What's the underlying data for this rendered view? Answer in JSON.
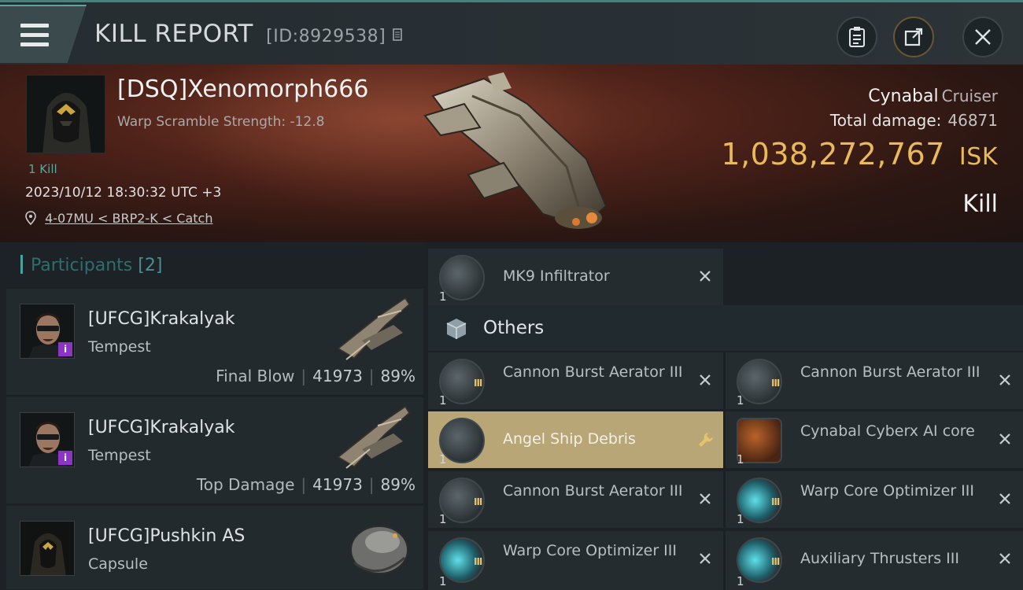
{
  "header": {
    "title": "KILL REPORT",
    "id_text": "[ID:8929538]",
    "buttons": {
      "report": "clipboard-icon",
      "share": "share-icon",
      "close": "close-icon"
    }
  },
  "victim": {
    "name": "[DSQ]Xenomorph666",
    "scramble": "Warp Scramble Strength: -12.8",
    "kill_count": "1 Kill",
    "datetime": "2023/10/12 18:30:32 UTC +3",
    "location": "4-07MU < BRP2-K < Catch",
    "ship": "Cynabal",
    "ship_class": "Cruiser",
    "total_damage_label": "Total damage:",
    "total_damage": "46871",
    "isk_value": "1,038,272,767",
    "isk_unit": "ISK",
    "result": "Kill"
  },
  "participants": {
    "title": "Participants",
    "count": "[2]",
    "list": [
      {
        "name": "[UFCG]Krakalyak",
        "ship": "Tempest",
        "role": "Final Blow",
        "damage": "41973",
        "percent": "89%"
      },
      {
        "name": "[UFCG]Krakalyak",
        "ship": "Tempest",
        "role": "Top Damage",
        "damage": "41973",
        "percent": "89%"
      },
      {
        "name": "[UFCG]Pushkin AS",
        "ship": "Capsule"
      }
    ]
  },
  "items": {
    "top": {
      "label": "MK9  Infiltrator",
      "qty": "1"
    },
    "others_title": "Others",
    "grid": [
      {
        "label": "Cannon Burst Aerator III",
        "qty": "1",
        "tier": "III"
      },
      {
        "label": "Cannon Burst Aerator III",
        "qty": "1",
        "tier": "III"
      },
      {
        "label": "Angel Ship Debris",
        "qty": "1",
        "highlight": true
      },
      {
        "label": "Cynabal Cyberx AI core",
        "qty": "1"
      },
      {
        "label": "Cannon Burst Aerator III",
        "qty": "1",
        "tier": "III"
      },
      {
        "label": "Warp Core Optimizer III",
        "qty": "1",
        "tier": "III"
      },
      {
        "label": "Warp Core Optimizer III",
        "qty": "1",
        "tier": "III"
      },
      {
        "label": "Auxiliary Thrusters III",
        "qty": "1",
        "tier": "III"
      }
    ]
  },
  "colors": {
    "accent": "#4aa1a0",
    "isk": "#e9b95a",
    "highlight": "#b9a676",
    "badge": "#8c35c4"
  }
}
